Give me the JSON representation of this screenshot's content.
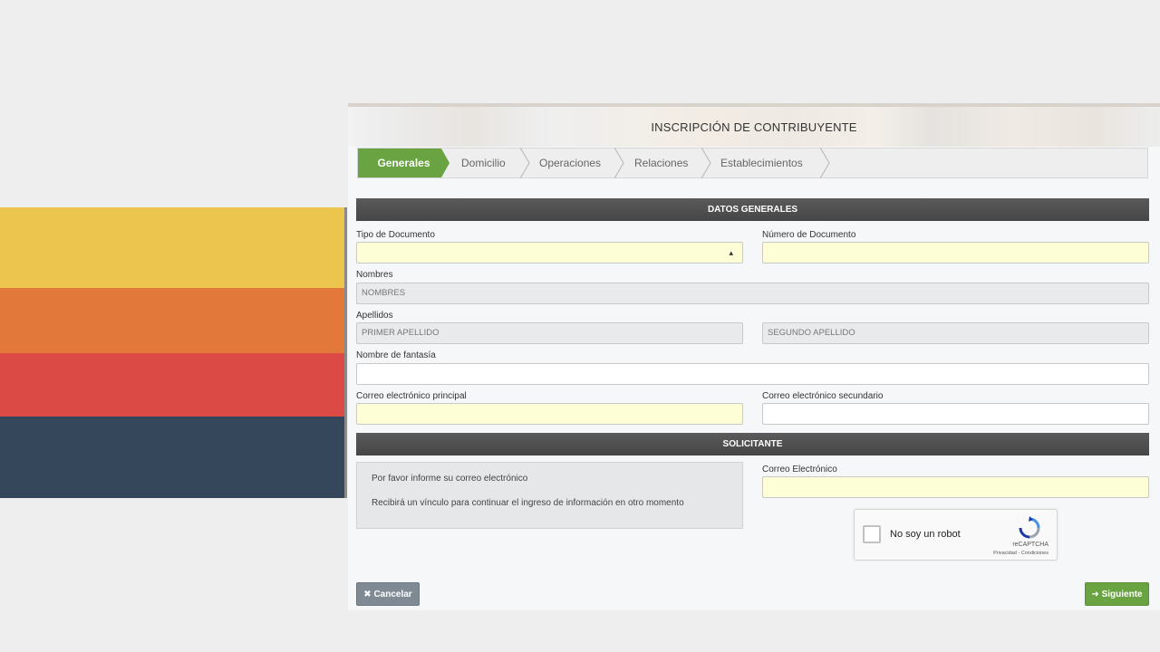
{
  "header": {
    "title": "INSCRIPCIÓN DE CONTRIBUYENTE"
  },
  "steps": [
    "Generales",
    "Domicilio",
    "Operaciones",
    "Relaciones",
    "Establecimientos"
  ],
  "datos_generales": {
    "section_title": "DATOS GENERALES",
    "tipo_documento": {
      "label": "Tipo de Documento",
      "value": ""
    },
    "numero_documento": {
      "label": "Número de Documento",
      "value": ""
    },
    "nombres": {
      "label": "Nombres",
      "placeholder": "NOMBRES"
    },
    "apellidos": {
      "label": "Apellidos",
      "primer_placeholder": "PRIMER APELLIDO",
      "segundo_placeholder": "SEGUNDO APELLIDO"
    },
    "nombre_fantasia": {
      "label": "Nombre de fantasía",
      "value": ""
    },
    "correo_principal": {
      "label": "Correo electrónico principal",
      "value": ""
    },
    "correo_secundario": {
      "label": "Correo electrónico secundario",
      "value": ""
    }
  },
  "solicitante": {
    "section_title": "SOLICITANTE",
    "info_line_1": "Por favor informe su correo electrónico",
    "info_line_2": "Recibirá un vínculo para continuar el ingreso de información en otro momento",
    "correo": {
      "label": "Correo Electrónico",
      "value": ""
    }
  },
  "captcha": {
    "label": "No soy un robot",
    "brand": "reCAPTCHA",
    "links": "Privacidad - Condiciones"
  },
  "buttons": {
    "cancel": "Cancelar",
    "next": "Siguiente"
  },
  "colors": {
    "stripe_yellow": "#ecc54e",
    "stripe_orange": "#e2793b",
    "stripe_red": "#dc4a46",
    "stripe_navy": "#34475b",
    "accent_green": "#6aa341",
    "section_bar": "#4f4f4f",
    "field_yellow": "#fdfdd6"
  }
}
